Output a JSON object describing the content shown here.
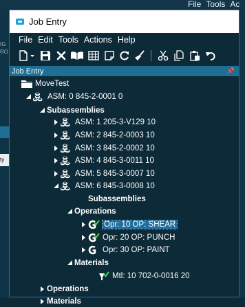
{
  "bg": {
    "menu": [
      "File",
      "Tools",
      "Ac"
    ],
    "left_frags": [
      "IG",
      "RO"
    ],
    "left_box_text": "ty"
  },
  "window": {
    "title": "Job Entry"
  },
  "menu": [
    "File",
    "Edit",
    "Tools",
    "Actions",
    "Help"
  ],
  "toolbar": {
    "icons": [
      "new-icon",
      "save-icon",
      "delete-icon",
      "open-book-icon",
      "grid-icon",
      "note-icon",
      "refresh-icon",
      "clear-icon",
      "cut-icon",
      "copy-icon",
      "paste-icon",
      "undo-icon"
    ]
  },
  "panel": {
    "title": "Job Entry"
  },
  "tree": [
    {
      "label": "MoveTest",
      "icon": "folder-icon",
      "toggle": "none",
      "bold": false
    },
    {
      "label": "ASM: 0 845-2-0001 0",
      "icon": "assembly-icon",
      "toggle": "expanded",
      "bold": false
    },
    {
      "label": "Subassemblies",
      "icon": "none",
      "toggle": "expanded",
      "bold": true
    },
    {
      "label": "ASM: 1 205-3-V129 10",
      "icon": "assembly-icon",
      "toggle": "collapsed",
      "bold": false
    },
    {
      "label": "ASM: 2 845-2-0003 10",
      "icon": "assembly-icon",
      "toggle": "collapsed",
      "bold": false
    },
    {
      "label": "ASM: 3 845-2-0002 10",
      "icon": "assembly-icon",
      "toggle": "collapsed",
      "bold": false
    },
    {
      "label": "ASM: 4 845-3-0011 10",
      "icon": "assembly-icon",
      "toggle": "collapsed",
      "bold": false
    },
    {
      "label": "ASM: 5 845-3-0007 10",
      "icon": "assembly-icon",
      "toggle": "collapsed",
      "bold": false
    },
    {
      "label": "ASM: 6 845-3-0008 10",
      "icon": "assembly-icon",
      "toggle": "expanded",
      "bold": false
    },
    {
      "label": "Subassemblies",
      "icon": "none",
      "toggle": "none",
      "bold": true
    },
    {
      "label": "Operations",
      "icon": "none",
      "toggle": "expanded",
      "bold": true
    },
    {
      "label": "Opr: 10 OP: SHEAR",
      "icon": "operation-check-icon",
      "toggle": "collapsed",
      "bold": false,
      "selected": true
    },
    {
      "label": "Opr: 20 OP: PUNCH",
      "icon": "operation-check-icon",
      "toggle": "collapsed",
      "bold": false
    },
    {
      "label": "Opr: 30 OP: PAINT",
      "icon": "operation-icon",
      "toggle": "collapsed",
      "bold": false
    },
    {
      "label": "Materials",
      "icon": "none",
      "toggle": "expanded",
      "bold": true
    },
    {
      "label": "Mtl: 10 702-0-0016 20",
      "icon": "material-check-icon",
      "toggle": "none",
      "bold": false
    },
    {
      "label": "Operations",
      "icon": "none",
      "toggle": "collapsed",
      "bold": true
    },
    {
      "label": "Materials",
      "icon": "none",
      "toggle": "collapsed",
      "bold": true
    }
  ]
}
